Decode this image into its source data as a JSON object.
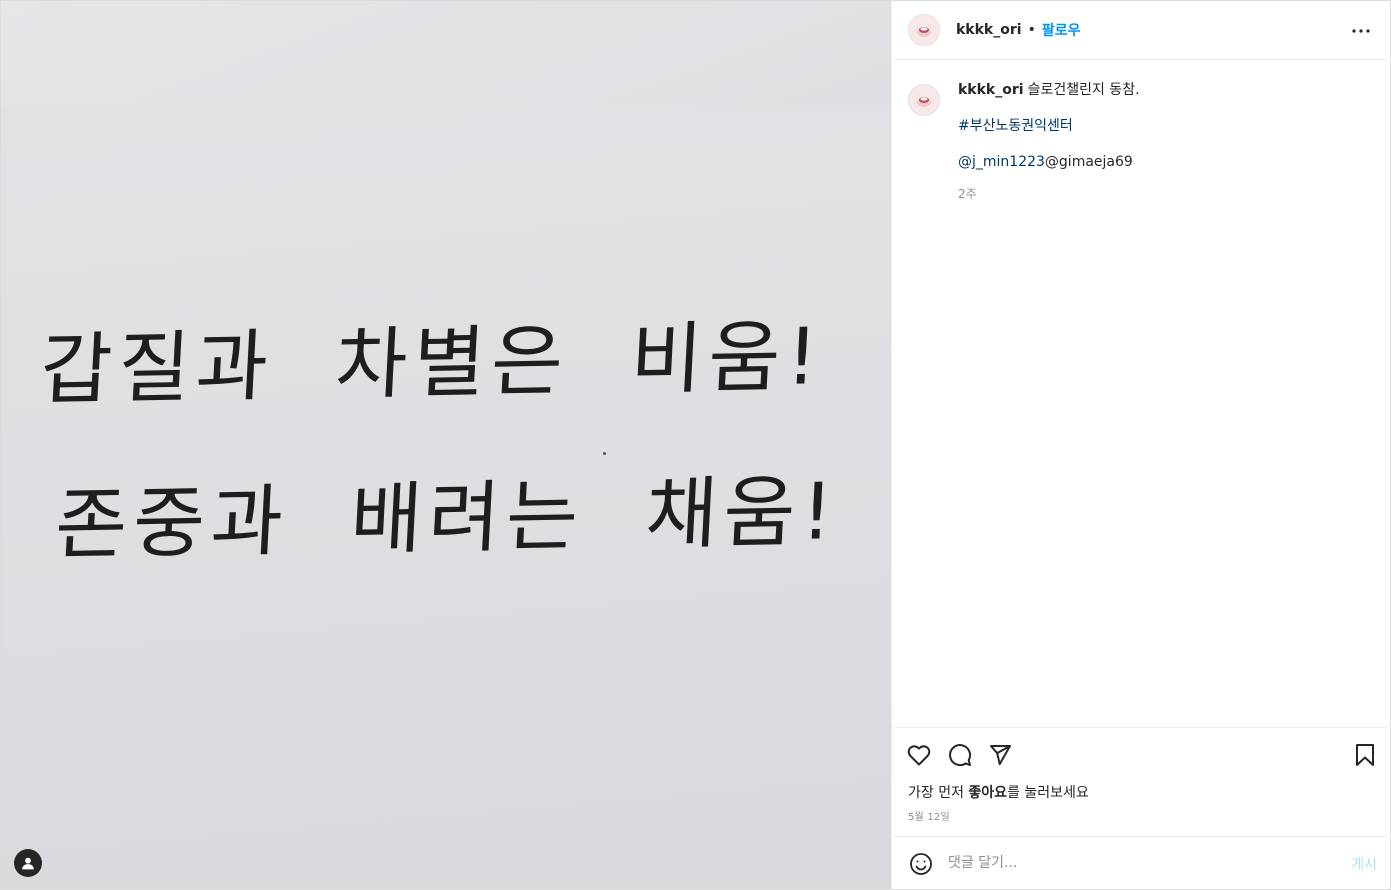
{
  "post": {
    "image_text": {
      "line1": "갑질과  차별은  비움!",
      "line2": "존중과  배려는  채움!"
    }
  },
  "header": {
    "username": "kkkk_ori",
    "separator": "•",
    "follow_label": "팔로우",
    "more_icon": "more-horizontal-icon"
  },
  "caption": {
    "username": "kkkk_ori",
    "text": "슬로건챌린지 동참.",
    "hashtag": "#부산노동권익센터",
    "mention1": "@j_min1223",
    "mention2": "@gimaeja69",
    "time_ago": "2주"
  },
  "actions": {
    "icons": [
      "heart-icon",
      "comment-icon",
      "share-icon",
      "bookmark-icon"
    ],
    "likes_prefix": "가장 먼저 ",
    "likes_bold": "좋아요",
    "likes_suffix": "를 눌러보세요",
    "date": "5월 12일"
  },
  "comment_box": {
    "placeholder": "댓글 달기...",
    "post_label": "게시",
    "emoji_icon": "smile-icon"
  },
  "colors": {
    "link_blue": "#0095f6",
    "tag_blue": "#00376b",
    "muted": "#8e8e8e",
    "post_disabled": "#b2dffc"
  }
}
